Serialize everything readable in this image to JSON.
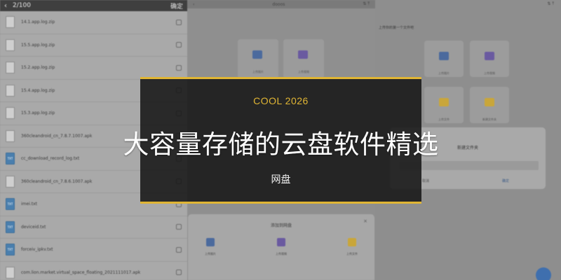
{
  "left_panel": {
    "header": {
      "back_icon": "chevron-left-icon",
      "counter": "2/100",
      "confirm": "确定"
    },
    "files": [
      {
        "name": "14.1.app.log.zip",
        "type": "doc"
      },
      {
        "name": "15.5.app.log.zip",
        "type": "doc"
      },
      {
        "name": "15.2.app.log.zip",
        "type": "doc"
      },
      {
        "name": "15.4.app.log.zip",
        "type": "doc"
      },
      {
        "name": "15.3.app.log.zip",
        "type": "doc"
      },
      {
        "name": "360cleandroid_cn_7.8.7.1007.apk",
        "type": "doc"
      },
      {
        "name": "cc_download_record_log.txt",
        "type": "txt"
      },
      {
        "name": "360cleandroid_cn_7.8.6.1007.apk",
        "type": "doc"
      },
      {
        "name": "imei.txt",
        "type": "txt"
      },
      {
        "name": "deviceid.txt",
        "type": "txt"
      },
      {
        "name": "forceiv_ipkv.txt",
        "type": "txt"
      },
      {
        "name": "com.lion.market.virtual_space_floating_2021111017.apk",
        "type": "doc"
      }
    ]
  },
  "middle_panel": {
    "header": {
      "back_icon": "chevron-left-icon",
      "title": "dooos",
      "sort_icon": "sort-icon",
      "upload_icon": "upload-icon"
    },
    "tiles": [
      {
        "label": "上传图片",
        "color": "#4b6a9d"
      },
      {
        "label": "上传视频",
        "color": "#6a5aa0"
      }
    ],
    "sheet": {
      "title": "添加到网盘",
      "close_icon": "close-icon",
      "options": [
        {
          "label": "上传图片",
          "color": "#4b6a9d"
        },
        {
          "label": "上传视频",
          "color": "#6a5aa0"
        },
        {
          "label": "上传文件",
          "color": "#c9a63a"
        }
      ]
    }
  },
  "right_panel": {
    "header": {
      "sort_icon": "sort-icon",
      "upload_icon": "upload-icon"
    },
    "title": "上传你的第一个文件吧",
    "tiles": [
      {
        "label": "上传图片",
        "color": "#4b6a9d"
      },
      {
        "label": "上传视频",
        "color": "#6a5aa0"
      },
      {
        "label": "上传文件",
        "color": "#c9a63a"
      },
      {
        "label": "新建文件夹",
        "color": "#c9a63a"
      }
    ],
    "dialog": {
      "title": "新建文件夹",
      "cancel": "取消",
      "confirm": "确定"
    }
  },
  "banner": {
    "kicker": "COOL 2026",
    "title": "大容量存储的云盘软件精选",
    "tag": "网盘",
    "accent_color": "#e0b534"
  }
}
